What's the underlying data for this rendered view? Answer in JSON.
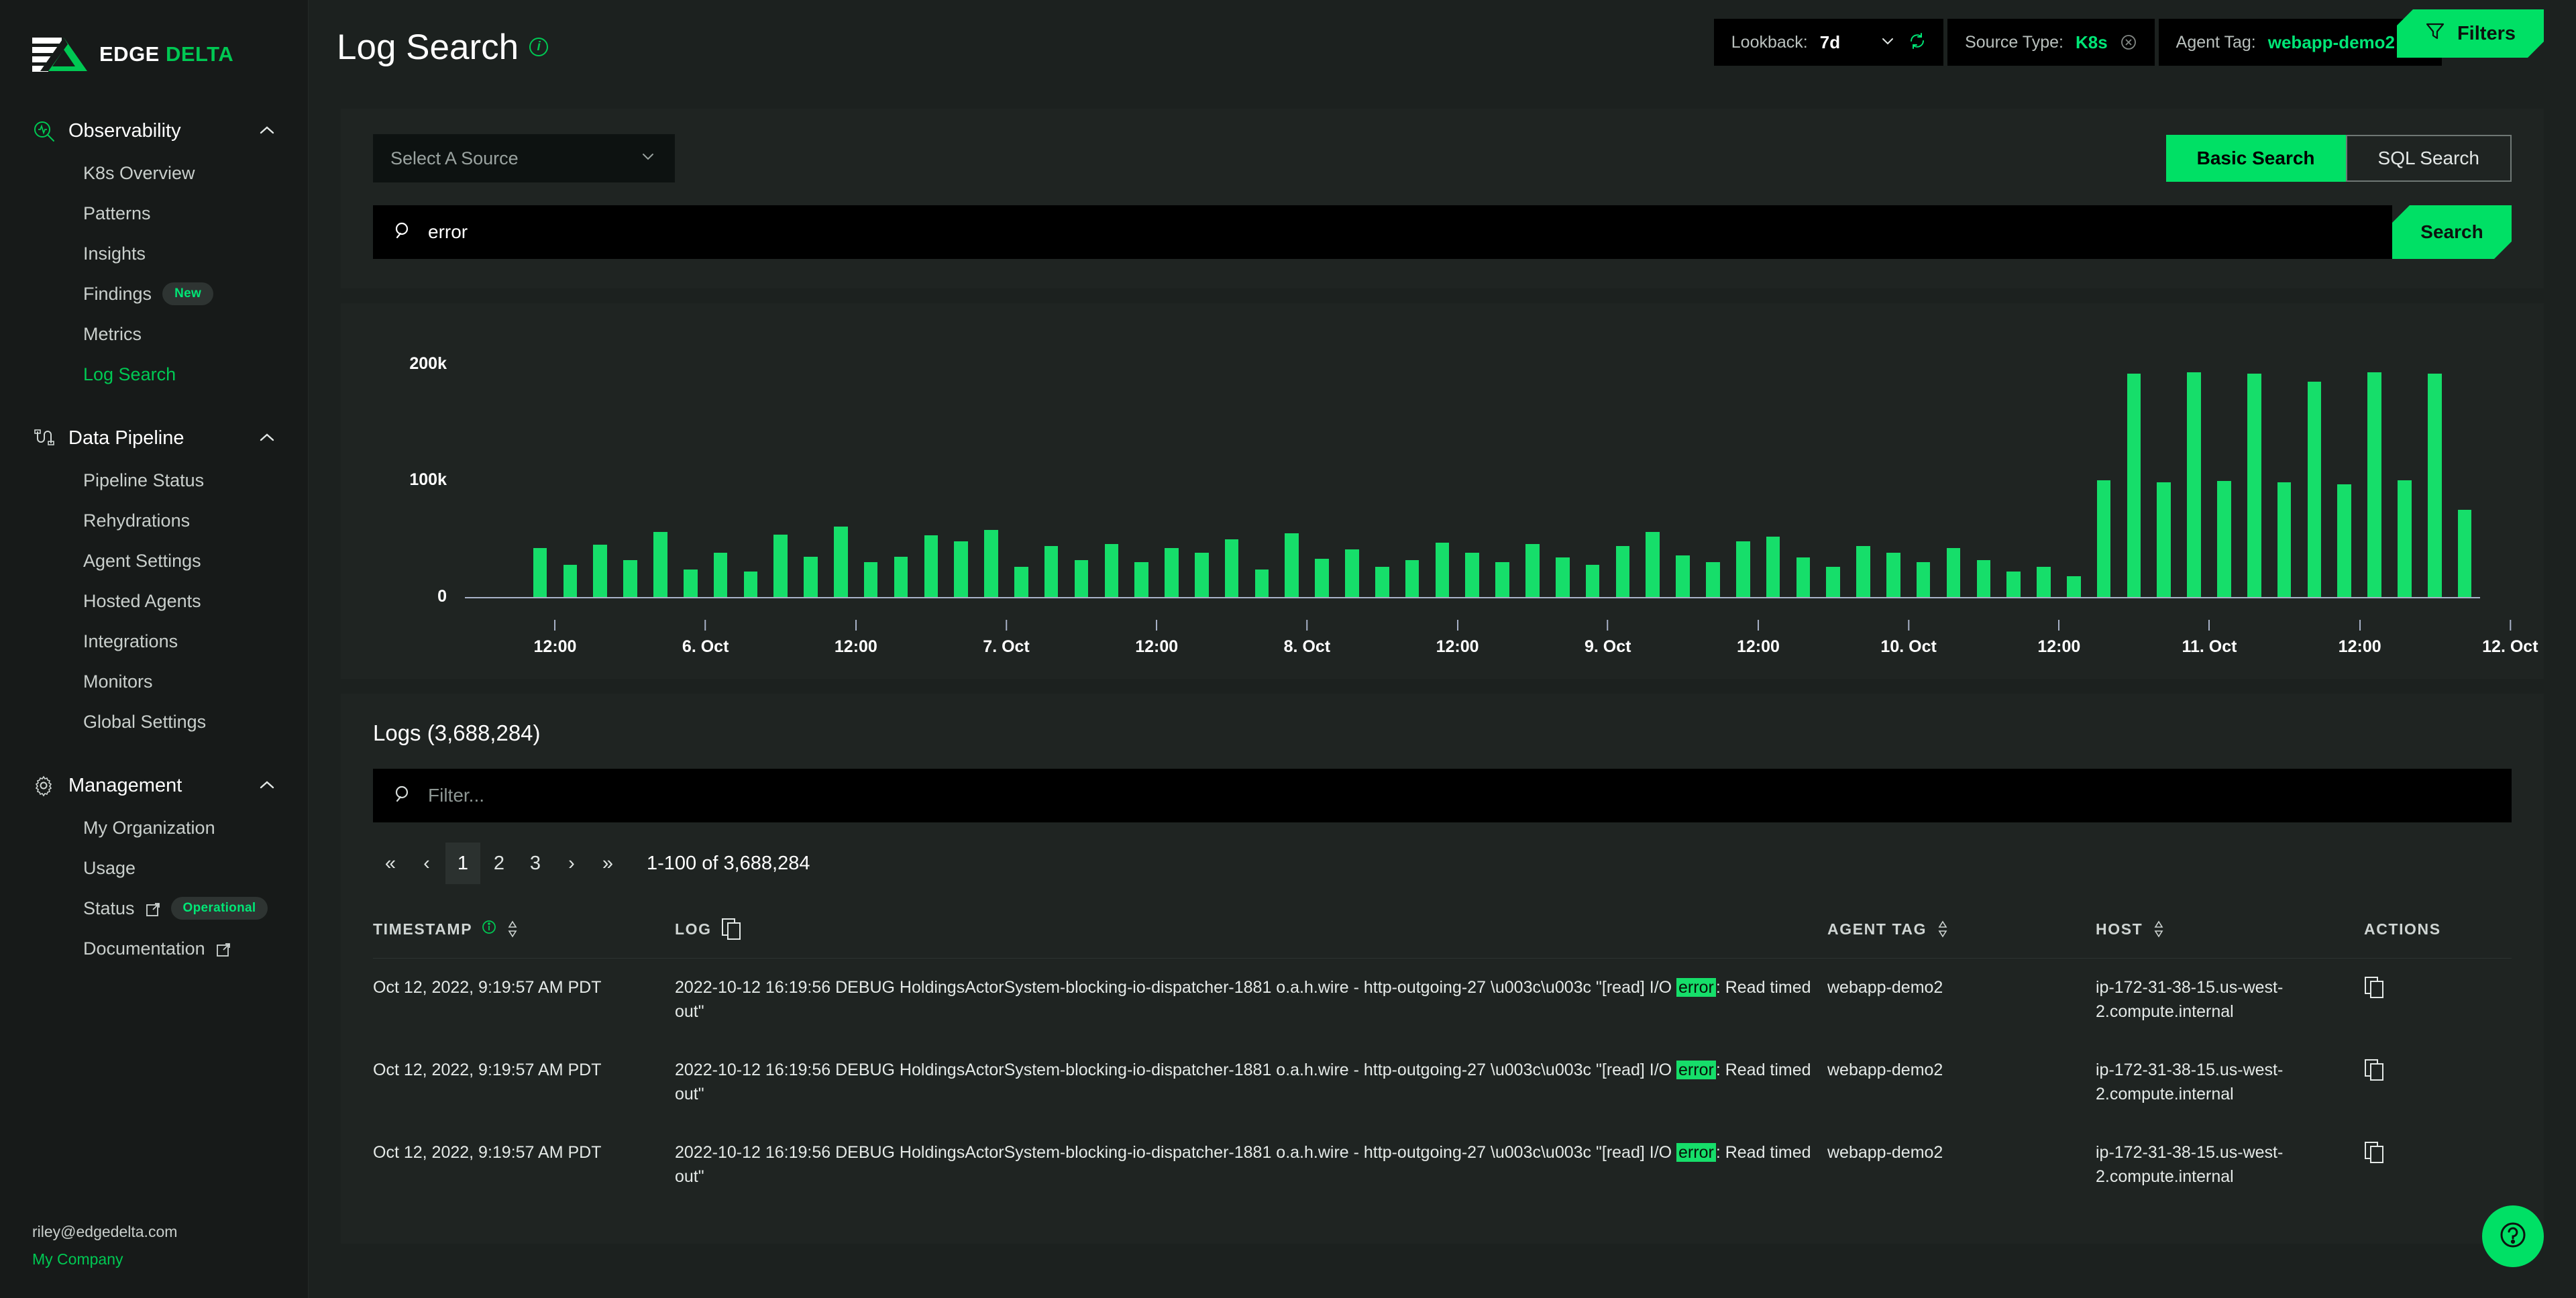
{
  "brand": {
    "edge": "EDGE",
    "delta": "DELTA"
  },
  "sidebar": {
    "groups": [
      {
        "label": "Observability",
        "icon": "observability-icon",
        "items": [
          {
            "label": "K8s Overview",
            "active": false
          },
          {
            "label": "Patterns",
            "active": false
          },
          {
            "label": "Insights",
            "active": false
          },
          {
            "label": "Findings",
            "active": false,
            "badge": "New"
          },
          {
            "label": "Metrics",
            "active": false
          },
          {
            "label": "Log Search",
            "active": true
          }
        ]
      },
      {
        "label": "Data Pipeline",
        "icon": "pipeline-icon",
        "items": [
          {
            "label": "Pipeline Status",
            "active": false
          },
          {
            "label": "Rehydrations",
            "active": false
          },
          {
            "label": "Agent Settings",
            "active": false
          },
          {
            "label": "Hosted Agents",
            "active": false
          },
          {
            "label": "Integrations",
            "active": false
          },
          {
            "label": "Monitors",
            "active": false
          },
          {
            "label": "Global Settings",
            "active": false
          }
        ]
      },
      {
        "label": "Management",
        "icon": "gear-icon",
        "items": [
          {
            "label": "My Organization",
            "active": false
          },
          {
            "label": "Usage",
            "active": false
          },
          {
            "label": "Status",
            "active": false,
            "external": true,
            "badge": "Operational"
          },
          {
            "label": "Documentation",
            "active": false,
            "external": true
          }
        ]
      }
    ],
    "footer": {
      "email": "riley@edgedelta.com",
      "company": "My Company"
    }
  },
  "header": {
    "title": "Log Search",
    "lookback_label": "Lookback:",
    "lookback_value": "7d",
    "source_type_label": "Source Type:",
    "source_type_value": "K8s",
    "agent_tag_label": "Agent Tag:",
    "agent_tag_value": "webapp-demo2",
    "filters_label": "Filters"
  },
  "search": {
    "source_placeholder": "Select A Source",
    "tab_basic": "Basic Search",
    "tab_sql": "SQL Search",
    "query_value": "error",
    "search_button": "Search"
  },
  "chart_data": {
    "type": "bar",
    "title": "",
    "xlabel": "",
    "ylabel": "",
    "ylim": [
      0,
      220000
    ],
    "yticks": [
      "0",
      "100k",
      "200k"
    ],
    "ytick_values": [
      0,
      100000,
      200000
    ],
    "grid": false,
    "legend": "none",
    "bar_color": "#16de6a",
    "xtick_labels": [
      "12:00",
      "6. Oct",
      "12:00",
      "7. Oct",
      "12:00",
      "8. Oct",
      "12:00",
      "9. Oct",
      "12:00",
      "10. Oct",
      "12:00",
      "11. Oct",
      "12:00",
      "12. Oct"
    ],
    "xtick_positions": [
      2.5,
      7.5,
      12.5,
      17.5,
      22.5,
      27.5,
      32.5,
      37.5,
      42.5,
      47.5,
      52.5,
      57.5,
      62.5,
      67.5
    ],
    "values": [
      0,
      0,
      42000,
      28000,
      45000,
      32000,
      56000,
      24000,
      38000,
      22000,
      54000,
      35000,
      61000,
      30000,
      35000,
      53000,
      48000,
      58000,
      26000,
      44000,
      32000,
      46000,
      30000,
      42000,
      38000,
      50000,
      24000,
      55000,
      33000,
      41000,
      26000,
      32000,
      47000,
      38000,
      30000,
      46000,
      34000,
      28000,
      44000,
      56000,
      36000,
      30000,
      48000,
      52000,
      34000,
      26000,
      44000,
      38000,
      30000,
      42000,
      32000,
      22000,
      26000,
      18000,
      101000,
      193000,
      99000,
      194000,
      100000,
      193000,
      99000,
      186000,
      97000,
      194000,
      101000,
      193000,
      75000
    ]
  },
  "logs": {
    "heading": "Logs (3,688,284)",
    "filter_placeholder": "Filter...",
    "pager": {
      "first": "«",
      "prev": "‹",
      "pages": [
        "1",
        "2",
        "3"
      ],
      "current": "1",
      "next": "›",
      "last": "»",
      "range_text": "1-100 of 3,688,284"
    },
    "columns": [
      "TIMESTAMP",
      "LOG",
      "AGENT TAG",
      "HOST",
      "ACTIONS"
    ],
    "rows": [
      {
        "timestamp": "Oct 12, 2022, 9:19:57 AM PDT",
        "log_pre": "2022-10-12 16:19:56 DEBUG HoldingsActorSystem-blocking-io-dispatcher-1881 o.a.h.wire - http-outgoing-27 \\u003c\\u003c \"[read] I/O ",
        "log_highlight": "error",
        "log_post": ": Read timed out\"",
        "agent_tag": "webapp-demo2",
        "host": "ip-172-31-38-15.us-west-2.compute.internal"
      },
      {
        "timestamp": "Oct 12, 2022, 9:19:57 AM PDT",
        "log_pre": "2022-10-12 16:19:56 DEBUG HoldingsActorSystem-blocking-io-dispatcher-1881 o.a.h.wire - http-outgoing-27 \\u003c\\u003c \"[read] I/O ",
        "log_highlight": "error",
        "log_post": ": Read timed out\"",
        "agent_tag": "webapp-demo2",
        "host": "ip-172-31-38-15.us-west-2.compute.internal"
      },
      {
        "timestamp": "Oct 12, 2022, 9:19:57 AM PDT",
        "log_pre": "2022-10-12 16:19:56 DEBUG HoldingsActorSystem-blocking-io-dispatcher-1881 o.a.h.wire - http-outgoing-27 \\u003c\\u003c \"[read] I/O ",
        "log_highlight": "error",
        "log_post": ": Read timed out\"",
        "agent_tag": "webapp-demo2",
        "host": "ip-172-31-38-15.us-west-2.compute.internal"
      }
    ]
  },
  "help": {
    "label": "?"
  },
  "colors": {
    "accent": "#00e065",
    "accent_text": "#00c853",
    "bar": "#16de6a",
    "panel": "#1f2422",
    "bg": "#1c211f",
    "sidebar": "#171a19"
  }
}
